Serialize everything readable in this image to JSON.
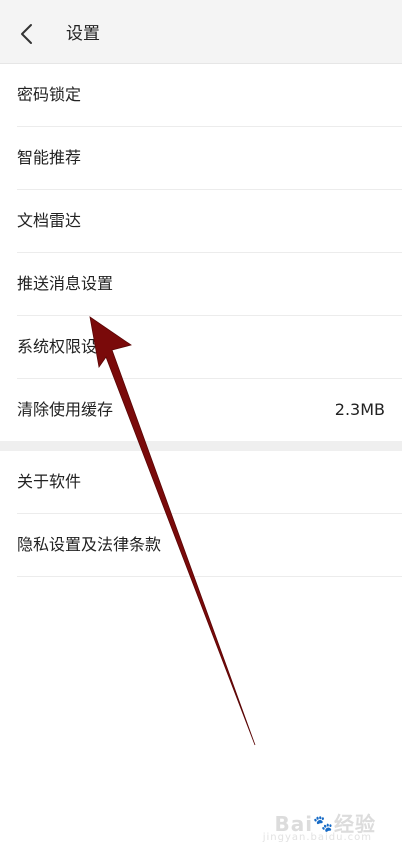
{
  "header": {
    "back_icon": "chevron-left-icon",
    "title": "设置"
  },
  "group1": {
    "items": [
      {
        "label": "密码锁定"
      },
      {
        "label": "智能推荐"
      },
      {
        "label": "文档雷达"
      },
      {
        "label": "推送消息设置"
      },
      {
        "label": "系统权限设置"
      },
      {
        "label": "清除使用缓存",
        "value": "2.3MB"
      }
    ]
  },
  "group2": {
    "items": [
      {
        "label": "关于软件"
      },
      {
        "label": "隐私设置及法律条款"
      }
    ]
  },
  "annotation": {
    "arrow_color": "#7a0a0a"
  },
  "watermark": {
    "brand": "Bai",
    "brand_suffix": "经验",
    "sub": "jingyan.baidu.com"
  }
}
